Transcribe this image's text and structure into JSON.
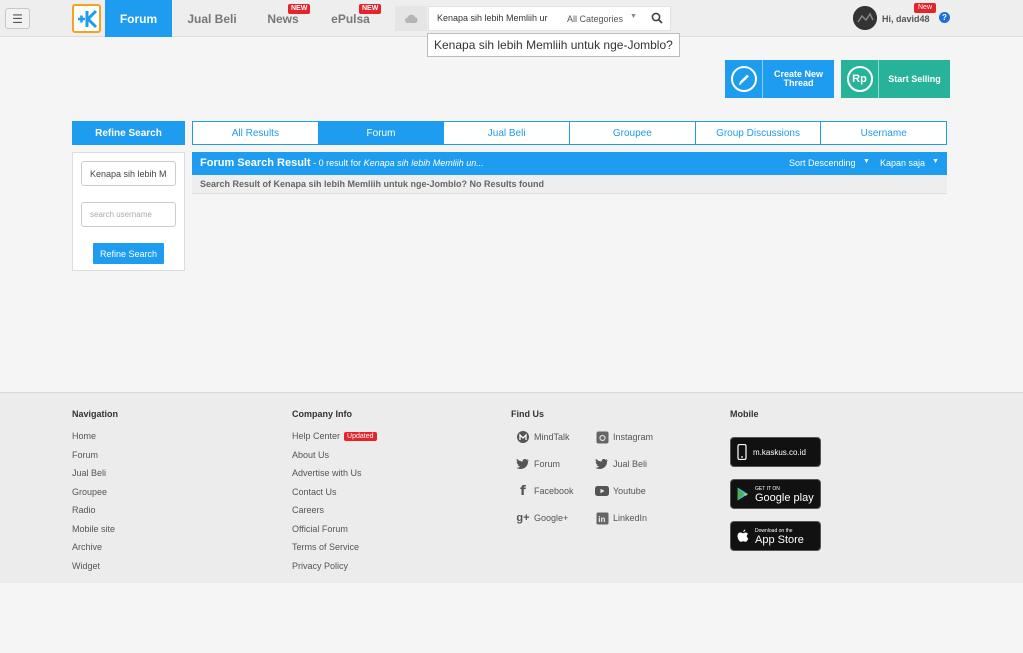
{
  "header": {
    "nav": [
      {
        "label": "Forum",
        "active": true,
        "badge": ""
      },
      {
        "label": "Jual Beli",
        "active": false,
        "badge": ""
      },
      {
        "label": "News",
        "active": false,
        "badge": "NEW"
      },
      {
        "label": "ePulsa",
        "active": false,
        "badge": "NEW"
      }
    ],
    "search_value": "Kenapa sih lebih Memliih ur",
    "category": "All Categories",
    "tooltip": "Kenapa sih lebih Memliih untuk nge-Jomblo?",
    "greeting": "Hi, david48",
    "user_badge": "New",
    "help": "?"
  },
  "actions": {
    "create_line1": "Create New",
    "create_line2": "Thread",
    "sell": "Start Selling",
    "sell_icon_text": "Rp"
  },
  "refine": {
    "title": "Refine Search",
    "query_value": "Kenapa sih lebih M",
    "username_placeholder": "search username",
    "button": "Refine Search"
  },
  "tabs": [
    {
      "label": "All Results",
      "active": false
    },
    {
      "label": "Forum",
      "active": true
    },
    {
      "label": "Jual Beli",
      "active": false
    },
    {
      "label": "Groupee",
      "active": false
    },
    {
      "label": "Group Discussions",
      "active": false
    },
    {
      "label": "Username",
      "active": false
    }
  ],
  "result": {
    "title": "Forum Search Result",
    "count": " - 0 result for ",
    "query": "Kenapa sih lebih Memliih un...",
    "sort": "Sort Descending",
    "time": "Kapan saja",
    "message": "Search Result of Kenapa sih lebih Memliih untuk nge-Jomblo? No Results found"
  },
  "footer": {
    "navigation": {
      "title": "Navigation",
      "links": [
        "Home",
        "Forum",
        "Jual Beli",
        "Groupee",
        "Radio",
        "Mobile site",
        "Archive",
        "Widget"
      ]
    },
    "company": {
      "title": "Company Info",
      "links": [
        "Help Center",
        "About Us",
        "Advertise with Us",
        "Contact Us",
        "Careers",
        "Official Forum",
        "Terms of Service",
        "Privacy Policy"
      ],
      "updated_badge": "Updated"
    },
    "find_us": {
      "title": "Find Us",
      "items": [
        {
          "label": "MindTalk",
          "icon": "mindtalk-icon"
        },
        {
          "label": "Instagram",
          "icon": "instagram-icon"
        },
        {
          "label": "Forum",
          "icon": "twitter-icon"
        },
        {
          "label": "Jual Beli",
          "icon": "twitter-icon"
        },
        {
          "label": "Facebook",
          "icon": "facebook-icon"
        },
        {
          "label": "Youtube",
          "icon": "youtube-icon"
        },
        {
          "label": "Google+",
          "icon": "google-plus-icon"
        },
        {
          "label": "LinkedIn",
          "icon": "linkedin-icon"
        }
      ]
    },
    "mobile": {
      "title": "Mobile",
      "site": "m.kaskus.co.id",
      "google_small": "GET IT ON",
      "google_big": "Google play",
      "apple_small": "Download on the",
      "apple_big": "App Store"
    }
  }
}
